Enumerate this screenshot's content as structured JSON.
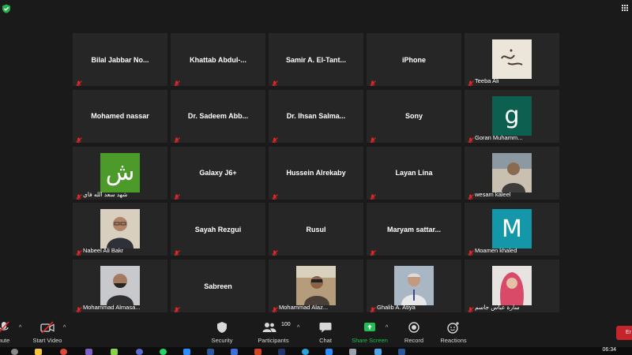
{
  "participants": [
    {
      "name": "Bilal Jabbar No...",
      "type": "name"
    },
    {
      "name": "Khattab Abdul-...",
      "type": "name"
    },
    {
      "name": "Samir A. El-Tant...",
      "type": "name"
    },
    {
      "name": "iPhone",
      "type": "name"
    },
    {
      "name": "Teeba Ali",
      "type": "image",
      "pic": "calligraphy"
    },
    {
      "name": "Mohamed nassar",
      "type": "name"
    },
    {
      "name": "Dr. Sadeem Abb...",
      "type": "name"
    },
    {
      "name": "Dr. Ihsan Salma...",
      "type": "name"
    },
    {
      "name": "Sony",
      "type": "name"
    },
    {
      "name": "Goran Muhamm...",
      "type": "letter",
      "letter": "g",
      "color": "#0d5f50"
    },
    {
      "name": "شهد سعد الله فاي",
      "type": "letter",
      "letter": "ش",
      "color": "#4c9a2a"
    },
    {
      "name": "Galaxy J6+",
      "type": "name"
    },
    {
      "name": "Hussein Alrekaby",
      "type": "name"
    },
    {
      "name": "Layan Lina",
      "type": "name"
    },
    {
      "name": "wesam kaleel",
      "type": "image",
      "pic": "person-outdoor"
    },
    {
      "name": "Nabeel Ali Bakr",
      "type": "image",
      "pic": "person-glasses"
    },
    {
      "name": "Sayah Rezgui",
      "type": "name"
    },
    {
      "name": "Rusul",
      "type": "name"
    },
    {
      "name": "Maryam sattar...",
      "type": "name"
    },
    {
      "name": "Moamen khaled",
      "type": "letter",
      "letter": "M",
      "color": "#1497a8"
    },
    {
      "name": "Mohammad Almasa...",
      "type": "image",
      "pic": "person-beard"
    },
    {
      "name": "Sabreen",
      "type": "name"
    },
    {
      "name": "Mohammad Alaz...",
      "type": "image",
      "pic": "person-desert"
    },
    {
      "name": "Ghalib A. Atiya",
      "type": "image",
      "pic": "person-older"
    },
    {
      "name": "سارة عباس جاسم",
      "type": "image",
      "pic": "person-hijab"
    }
  ],
  "toolbar": {
    "mute_label": "nute",
    "video_label": "Start Video",
    "security_label": "Security",
    "participants_label": "Participants",
    "participants_count": "100",
    "chat_label": "Chat",
    "share_label": "Share Screen",
    "record_label": "Record",
    "reactions_label": "Reactions",
    "end_label": "Er"
  },
  "colors": {
    "background": "#1a1a1a",
    "tile": "#262626",
    "share_green": "#1fbf53",
    "mute_red": "#e02828",
    "end_red": "#c4242a"
  },
  "taskbar": {
    "clock": "06:34"
  }
}
